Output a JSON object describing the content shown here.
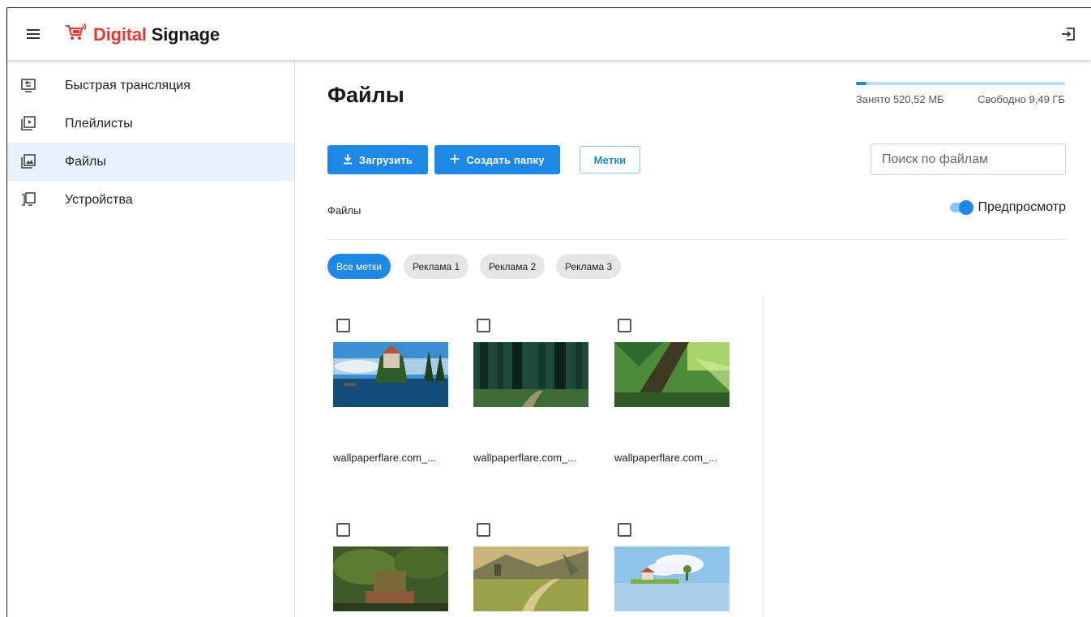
{
  "app": {
    "logo_red": "Digital",
    "logo_dark": "Signage"
  },
  "sidebar": {
    "items": [
      {
        "label": "Быстрая трансляция",
        "icon": "cast-screen-icon"
      },
      {
        "label": "Плейлисты",
        "icon": "playlist-icon"
      },
      {
        "label": "Файлы",
        "icon": "image-library-icon",
        "active": true
      },
      {
        "label": "Устройства",
        "icon": "devices-icon"
      }
    ]
  },
  "main": {
    "title": "Файлы",
    "storage": {
      "used_label": "Занято 520,52 МБ",
      "free_label": "Свободно 9,49 ГБ",
      "used_fraction": 0.05
    },
    "toolbar": {
      "upload_label": "Загрузить",
      "create_folder_label": "Создать папку",
      "tags_label": "Метки"
    },
    "search": {
      "placeholder": "Поиск по файлам"
    },
    "breadcrumb": "Файлы",
    "preview": {
      "label": "Предпросмотр",
      "enabled": true
    },
    "chips": [
      "Все метки",
      "Реклама 1",
      "Реклама 2",
      "Реклама 3"
    ],
    "files": [
      {
        "name": "wallpaperflare.com_..."
      },
      {
        "name": "wallpaperflare.com_..."
      },
      {
        "name": "wallpaperflare.com_..."
      },
      {
        "name": ""
      },
      {
        "name": ""
      },
      {
        "name": ""
      }
    ]
  },
  "colors": {
    "accent": "#1e88e5",
    "brand_red": "#e53935",
    "active_bg": "#e8f2fc"
  }
}
